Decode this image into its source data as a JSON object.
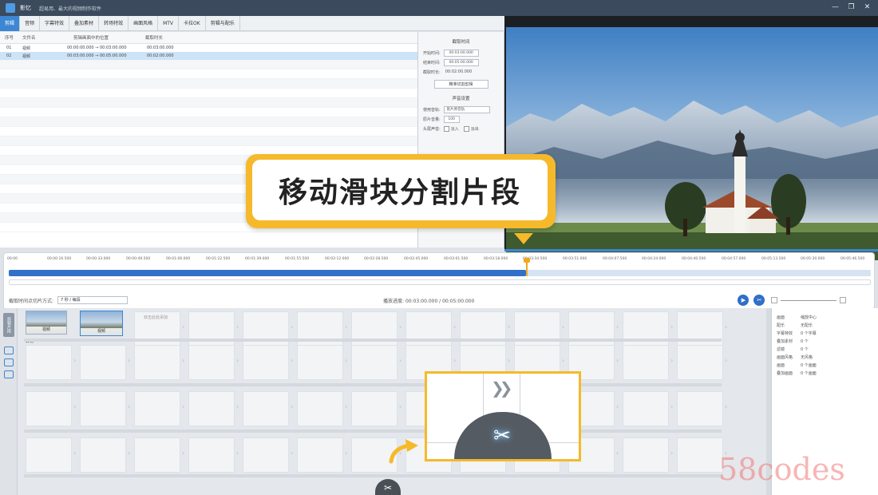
{
  "window": {
    "app_name": "影忆",
    "title_text": "超易用、最大的视频制作软件",
    "controls": [
      "—",
      "❐",
      "✕"
    ]
  },
  "menu": {
    "tabs": [
      "剪辑",
      "音频",
      "字幕特效",
      "叠加素材",
      "转场特效",
      "画面风格",
      "MTV",
      "卡拉OK",
      "剪辑与配乐"
    ],
    "active_index": 0
  },
  "list": {
    "headers": [
      "序号",
      "文件名",
      "剪辑画面中的位置",
      "截取时长"
    ],
    "rows": [
      {
        "no": "01",
        "name": "视频",
        "pos": "00:00:00.000 → 00:03:00.000",
        "len": "00:03:00.000",
        "selected": false
      },
      {
        "no": "02",
        "name": "视频",
        "pos": "00:03:00.000 → 00:05:00.000",
        "len": "00:02:00.000",
        "selected": true
      }
    ]
  },
  "props_panel": {
    "section1_title": "截取时间",
    "start_label": "开始时间:",
    "start_value": "00:03:00.000",
    "end_label": "结束时间:",
    "end_value": "00:05:00.000",
    "duration_label": "截取时长:",
    "duration_value": "00:02:00.000",
    "precise_button": "精准切割剪辑",
    "section2_title": "声音设置",
    "use_track_label": "使用音轨:",
    "use_track_value": "影片原音轨",
    "orig_volume_label": "原片音量:",
    "orig_volume_value": "100",
    "fade_label": "头尾声音:",
    "fade_in_label": "淡入",
    "fade_out_label": "淡出"
  },
  "callout": {
    "text": "移动滑块分割片段"
  },
  "timeline": {
    "ticks": [
      "00:00",
      "00:00:16.500",
      "00:00:33.000",
      "00:00:49.500",
      "00:01:06.000",
      "00:01:22.500",
      "00:01:39.000",
      "00:01:55.500",
      "00:02:12.000",
      "00:02:28.500",
      "00:02:45.000",
      "00:03:01.500",
      "00:03:18.000",
      "00:03:34.500",
      "00:03:51.000",
      "00:04:07.500",
      "00:04:24.000",
      "00:04:40.500",
      "00:04:57.000",
      "00:05:13.500",
      "00:05:30.000",
      "00:05:46.500"
    ],
    "progress_fraction": 0.6,
    "dropdown_label": "截取时间点切片方式:",
    "dropdown_value": "7 秒 / 每段",
    "time_readout": "播放进度: 00:03:00.000 / 00:05:00.000"
  },
  "storyboard": {
    "side_tab": "剪辑片段",
    "clips": [
      {
        "label": "视频"
      },
      {
        "label": "视频"
      }
    ],
    "hint_text": "双击此处添加",
    "row_label": "转场"
  },
  "right_props": [
    {
      "k": "画面",
      "v": "缩放中心"
    },
    {
      "k": "配乐",
      "v": "无配乐"
    },
    {
      "k": "字幕特效",
      "v": "0 个字幕"
    },
    {
      "k": "叠加素材",
      "v": "0 个"
    },
    {
      "k": "滤镜",
      "v": "0 个"
    },
    {
      "k": "画面风格",
      "v": "无风格"
    },
    {
      "k": "画面",
      "v": "0 个画面"
    },
    {
      "k": "叠加画面",
      "v": "0 个画面"
    }
  ],
  "watermark": "58codes",
  "colors": {
    "accent": "#3c86d4",
    "callout": "#f5b92b",
    "playhead": "#f0a81c"
  }
}
